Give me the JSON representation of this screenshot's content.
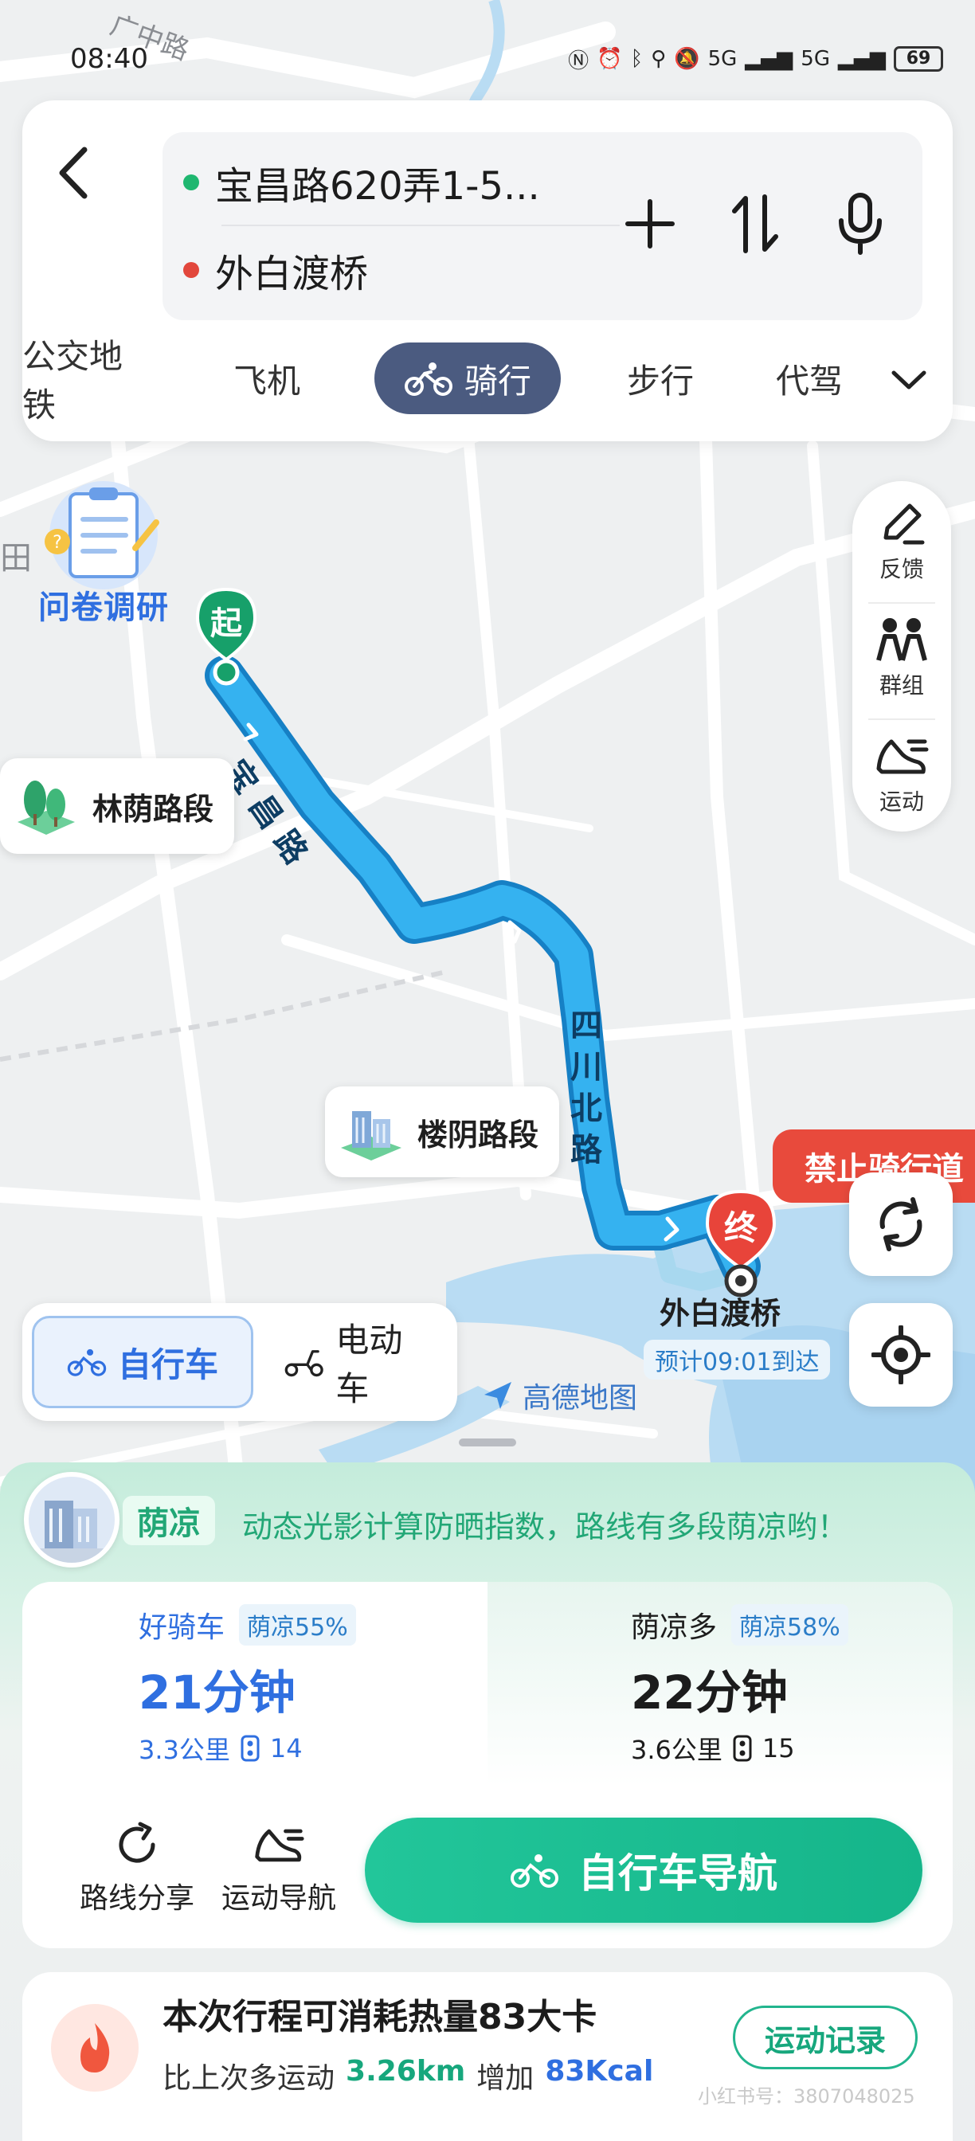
{
  "status_bar": {
    "time": "08:40",
    "battery": "69",
    "signal_labels": [
      "5G",
      "5G"
    ]
  },
  "route": {
    "start": "宝昌路620弄1-5...",
    "end": "外白渡桥"
  },
  "modes": [
    "公交地铁",
    "飞机",
    "骑行",
    "步行",
    "代驾"
  ],
  "active_mode": "骑行",
  "tools": [
    {
      "label": "反馈",
      "icon": "pencil-feedback-icon"
    },
    {
      "label": "群组",
      "icon": "group-people-icon"
    },
    {
      "label": "运动",
      "icon": "running-shoe-icon"
    }
  ],
  "map": {
    "survey_label": "问卷调研",
    "street_top": "广中路",
    "field_label": "田",
    "start_marker": "起",
    "end_marker": "终",
    "road1_label": "宝昌路",
    "road2_label": "四川北路",
    "shade_chip": "林荫路段",
    "building_chip": "楼阴路段",
    "no_ride": "禁止骑行道",
    "destination": "外白渡桥",
    "eta": "预计09:01到达",
    "logo": "高德地图"
  },
  "bike_types": {
    "active": "自行车",
    "other": "电动车"
  },
  "shade_banner": {
    "tag": "荫凉",
    "text": "动态光影计算防晒指数，路线有多段荫凉哟！"
  },
  "options": [
    {
      "name": "好骑车",
      "badge": "荫凉55%",
      "time": "21分钟",
      "distance": "3.3公里",
      "lights": "14"
    },
    {
      "name": "荫凉多",
      "badge": "荫凉58%",
      "time": "22分钟",
      "distance": "3.6公里",
      "lights": "15"
    }
  ],
  "actions": {
    "share": "路线分享",
    "sport_nav": "运动导航",
    "navigate": "自行车导航"
  },
  "calorie": {
    "title": "本次行程可消耗热量83大卡",
    "prefix": "比上次多运动",
    "distance": "3.26km",
    "mid": "增加",
    "kcal": "83Kcal",
    "button": "运动记录"
  },
  "watermark": "小红书号：3807048025",
  "colors": {
    "route_blue": "#2aa4ea",
    "accent_green": "#17a77d",
    "danger_red": "#e84a3c",
    "tab_active": "#4b5b80"
  }
}
